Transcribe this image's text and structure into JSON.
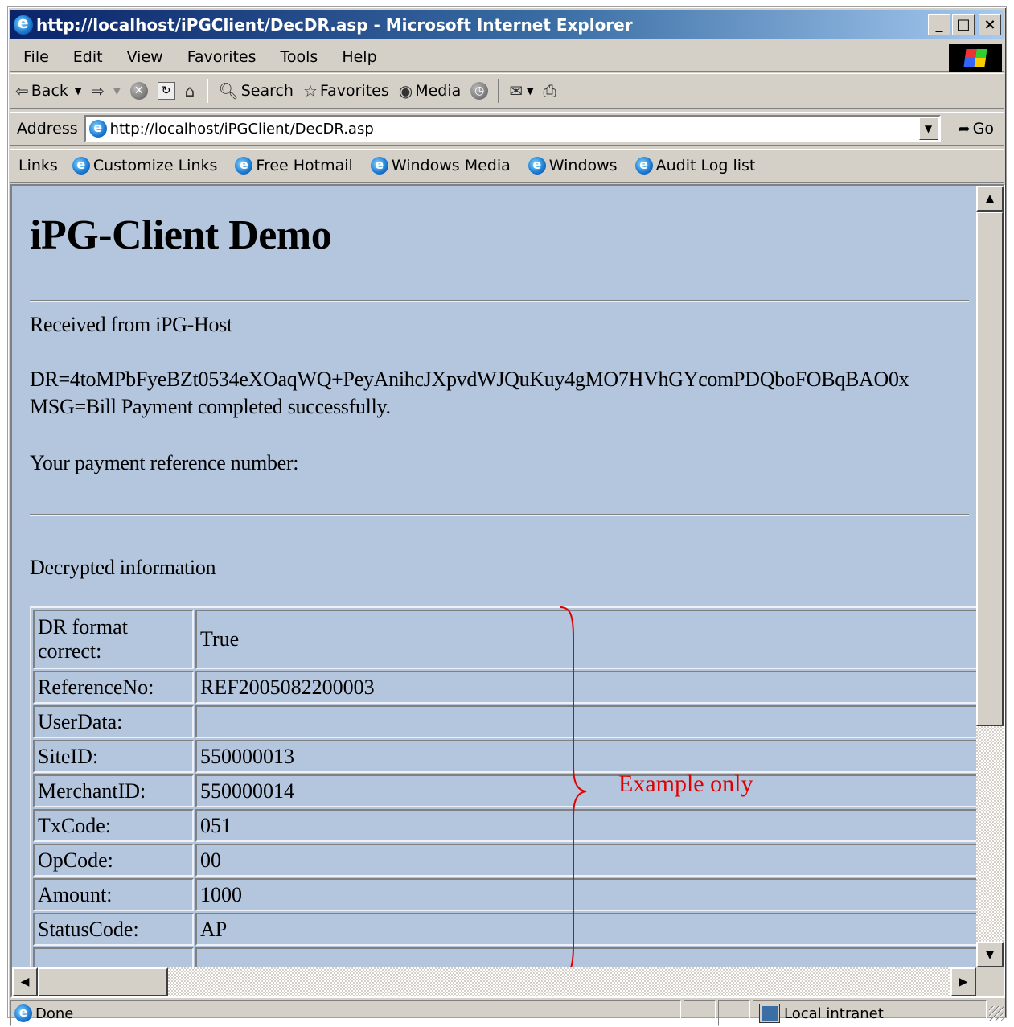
{
  "window": {
    "title": "http://localhost/iPGClient/DecDR.asp - Microsoft Internet Explorer",
    "minimize_glyph": "_",
    "maximize_glyph": "□",
    "close_glyph": "×"
  },
  "menubar": {
    "items": [
      {
        "label": "File",
        "key": "F"
      },
      {
        "label": "Edit",
        "key": "E"
      },
      {
        "label": "View",
        "key": "V"
      },
      {
        "label": "Favorites",
        "key": "a"
      },
      {
        "label": "Tools",
        "key": "T"
      },
      {
        "label": "Help",
        "key": "H"
      }
    ]
  },
  "toolbar": {
    "back_label": "Back",
    "search_label": "Search",
    "favorites_label": "Favorites",
    "media_label": "Media",
    "icons": [
      "back-arrow-icon",
      "forward-arrow-icon",
      "stop-icon",
      "refresh-icon",
      "home-icon",
      "search-icon",
      "favorites-icon",
      "media-icon",
      "history-icon",
      "mail-icon",
      "print-icon"
    ]
  },
  "address": {
    "label": "Address",
    "url": "http://localhost/iPGClient/DecDR.asp",
    "go_label": "Go"
  },
  "links": {
    "label": "Links",
    "items": [
      "Customize Links",
      "Free Hotmail",
      "Windows Media",
      "Windows",
      "Audit Log list"
    ]
  },
  "page": {
    "heading": "iPG-Client Demo",
    "received": "Received from iPG-Host",
    "dr": "DR=4toMPbFyeBZt0534eXOaqWQ+PeyAnihcJXpvdWJQuKuy4gMO7HVhGYcomPDQboFOBqBAO0x",
    "msg": "MSG=Bill Payment completed successfully.",
    "reference_prompt": "Your payment reference number:",
    "decrypted_title": "Decrypted information",
    "rows": [
      {
        "key": "DR format correct:",
        "value": "True"
      },
      {
        "key": "ReferenceNo:",
        "value": "REF2005082200003"
      },
      {
        "key": "UserData:",
        "value": ""
      },
      {
        "key": "SiteID:",
        "value": "550000013"
      },
      {
        "key": "MerchantID:",
        "value": "550000014"
      },
      {
        "key": "TxCode:",
        "value": "051"
      },
      {
        "key": "OpCode:",
        "value": "00"
      },
      {
        "key": "Amount:",
        "value": "1000"
      },
      {
        "key": "StatusCode:",
        "value": "AP"
      },
      {
        "key": "",
        "value": ""
      }
    ],
    "annotation": "Example only",
    "annotation_color": "#e00000",
    "background": "#b4c6de"
  },
  "statusbar": {
    "status": "Done",
    "zone": "Local intranet"
  }
}
